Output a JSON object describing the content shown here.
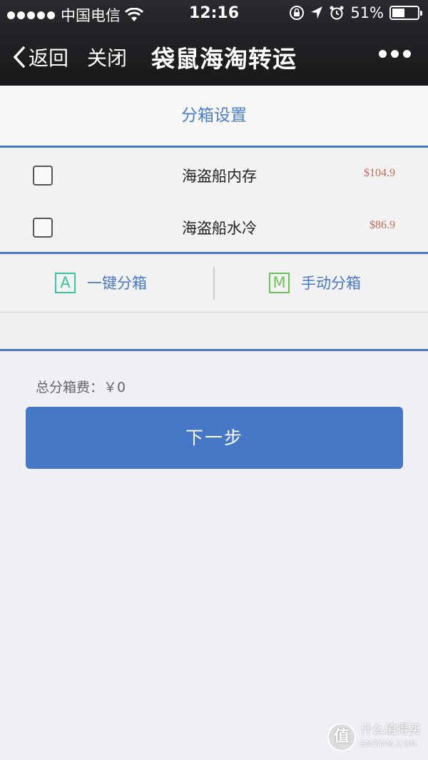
{
  "status_bar": {
    "carrier": "中国电信",
    "time": "12:16",
    "battery_text": "51%",
    "battery_level": 0.51
  },
  "nav": {
    "back_label": "返回",
    "close_label": "关闭",
    "title": "袋鼠海淘转运"
  },
  "section": {
    "title": "分箱设置"
  },
  "items": [
    {
      "name": "海盗船内存",
      "price": "$104.9"
    },
    {
      "name": "海盗船水冷",
      "price": "$86.9"
    }
  ],
  "actions": {
    "auto_icon": "A",
    "auto_label": "一键分箱",
    "manual_icon": "M",
    "manual_label": "手动分箱"
  },
  "summary": {
    "total_label": "总分箱费：￥0"
  },
  "next_button": {
    "label": "下一步"
  },
  "watermark": {
    "logo_char": "值",
    "text": "什么值得买",
    "sub": "SMZDM.COM"
  },
  "colors": {
    "accent": "#4677c7",
    "price": "#c36a5a",
    "auto_icon": "#3cc3a0",
    "manual_icon": "#6cc25b"
  }
}
